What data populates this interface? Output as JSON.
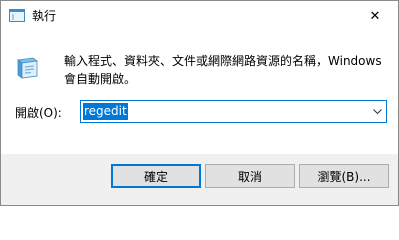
{
  "window": {
    "title": "執行",
    "close_label": "✕"
  },
  "icons": {
    "app": "run-icon",
    "big": "run-icon",
    "close": "close-icon",
    "dropdown": "chevron-down-icon"
  },
  "main": {
    "description": "輸入程式、資料夾、文件或網際網路資源的名稱，Windows 會自動開啟。",
    "open_label": "開啟(O):",
    "input_value": "regedit"
  },
  "buttons": {
    "ok": "確定",
    "cancel": "取消",
    "browse": "瀏覽(B)..."
  },
  "colors": {
    "accent": "#0078d7",
    "footer_bg": "#f0f0f0",
    "button_bg": "#e1e1e1"
  }
}
